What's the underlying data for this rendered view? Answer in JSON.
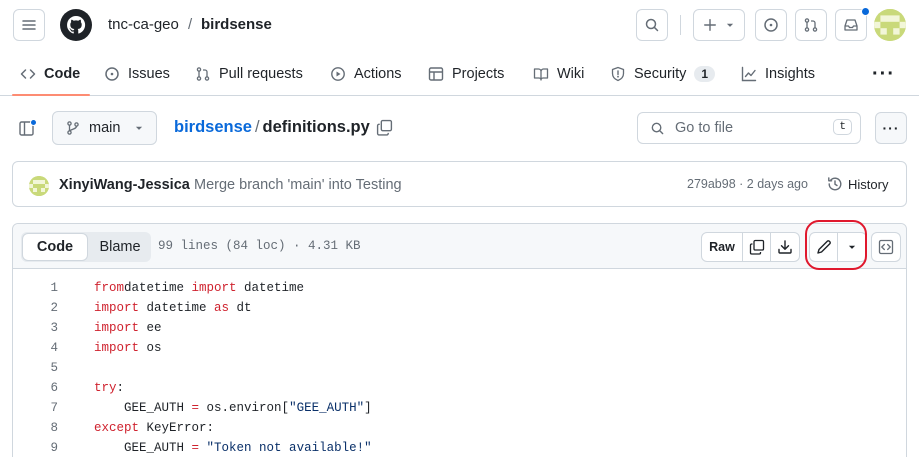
{
  "header": {
    "owner": "tnc-ca-geo",
    "separator": "/",
    "repo": "birdsense"
  },
  "tabs": [
    {
      "label": "Code",
      "icon": "code-icon"
    },
    {
      "label": "Issues",
      "icon": "issue-opened-icon"
    },
    {
      "label": "Pull requests",
      "icon": "git-pull-request-icon"
    },
    {
      "label": "Actions",
      "icon": "play-icon"
    },
    {
      "label": "Projects",
      "icon": "table-icon"
    },
    {
      "label": "Wiki",
      "icon": "book-icon"
    },
    {
      "label": "Security",
      "icon": "shield-icon",
      "count": "1"
    },
    {
      "label": "Insights",
      "icon": "graph-icon"
    }
  ],
  "filebar": {
    "branch": "main",
    "repo_link": "birdsense",
    "path_sep": "/",
    "filename": "definitions.py",
    "goto_placeholder": "Go to file",
    "goto_shortcut": "t"
  },
  "commit": {
    "author": "XinyiWang-Jessica",
    "message": "Merge branch 'main' into Testing",
    "meta": "279ab98 · 2 days ago",
    "history_label": "History"
  },
  "file": {
    "code_tab": "Code",
    "blame_tab": "Blame",
    "info": "99 lines (84 loc) · 4.31 KB",
    "raw_label": "Raw"
  },
  "code_lines": [
    {
      "n": "1",
      "tokens": [
        [
          "kw",
          "from"
        ],
        [
          "",
          "datetime "
        ],
        [
          "kw",
          "import"
        ],
        [
          "",
          " datetime"
        ]
      ]
    },
    {
      "n": "2",
      "tokens": [
        [
          "kw",
          "import"
        ],
        [
          "",
          " datetime "
        ],
        [
          "kw",
          "as"
        ],
        [
          "",
          " dt"
        ]
      ]
    },
    {
      "n": "3",
      "tokens": [
        [
          "kw",
          "import"
        ],
        [
          "",
          " ee"
        ]
      ]
    },
    {
      "n": "4",
      "tokens": [
        [
          "kw",
          "import"
        ],
        [
          "",
          " os"
        ]
      ]
    },
    {
      "n": "5",
      "tokens": []
    },
    {
      "n": "6",
      "tokens": [
        [
          "kw",
          "try"
        ],
        [
          "",
          ":"
        ]
      ]
    },
    {
      "n": "7",
      "tokens": [
        [
          "",
          "    GEE_AUTH "
        ],
        [
          "kw",
          "="
        ],
        [
          "",
          " os.environ["
        ],
        [
          "str",
          "\"GEE_AUTH\""
        ],
        [
          "",
          "]"
        ]
      ]
    },
    {
      "n": "8",
      "tokens": [
        [
          "kw",
          "except"
        ],
        [
          "",
          " KeyError:"
        ]
      ]
    },
    {
      "n": "9",
      "tokens": [
        [
          "",
          "    GEE_AUTH "
        ],
        [
          "kw",
          "="
        ],
        [
          "",
          ""
        ],
        [
          "str",
          " \"Token not available!\""
        ]
      ]
    }
  ],
  "colors": {
    "accent_link": "#0969da",
    "tab_underline": "#fd8c73",
    "keyword": "#cf222e",
    "string": "#0a3069",
    "highlight_ring": "#e0182d"
  }
}
